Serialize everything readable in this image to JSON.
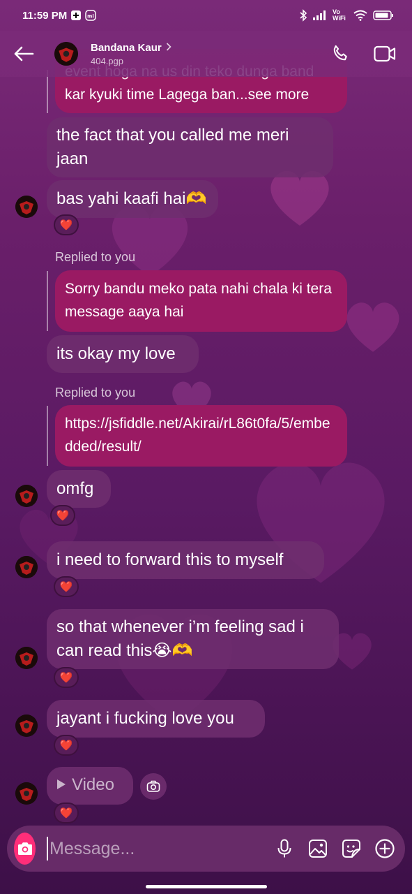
{
  "status_bar": {
    "time": "11:59 PM",
    "network_label": "Vo WiFi"
  },
  "header": {
    "name": "Bandana Kaur",
    "subtitle": "404.pgp"
  },
  "messages": {
    "top_quote_line1": "event hoga na us din teko dunga band",
    "top_quote_line2": "kar kyuki time Lagega ban...see more",
    "m1": "the fact that you called me meri jaan",
    "m2": "bas yahi kaafi hai🫶",
    "reply_label_1": "Replied to you",
    "quote_1": "Sorry bandu meko pata nahi chala ki tera message aaya hai",
    "m3": "its okay my love",
    "reply_label_2": "Replied to you",
    "quote_2": "https://jsfiddle.net/Akirai/rL86t0fa/5/embedded/result/",
    "m4": "omfg",
    "m5": "i need to forward this to myself",
    "m6": "so that whenever i’m feeling sad i can read this😭🫶",
    "m7": "jayant i fucking love you",
    "video_label": "Video",
    "reaction": "❤️"
  },
  "composer": {
    "placeholder": "Message..."
  },
  "colors": {
    "accent": "#ff2e79",
    "quote_bubble": "#9a1a63",
    "incoming_bubble": "#6e2d6e"
  },
  "icons": [
    "back-arrow-icon",
    "chevron-right-icon",
    "phone-icon",
    "video-camera-icon",
    "camera-icon",
    "microphone-icon",
    "gallery-icon",
    "sticker-icon",
    "plus-icon",
    "play-icon"
  ]
}
